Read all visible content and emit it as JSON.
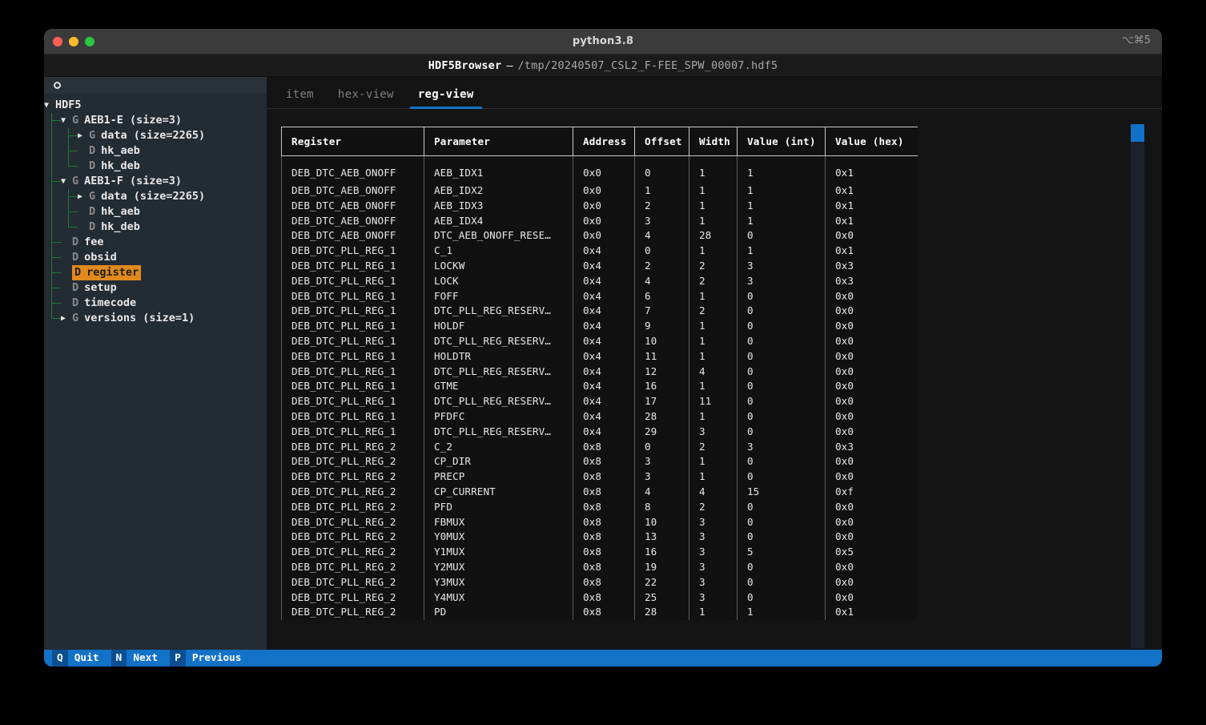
{
  "window": {
    "title": "python3.8",
    "shortcut": "⌥⌘5",
    "traffic_lights": [
      "close",
      "minimize",
      "zoom"
    ]
  },
  "app_header": {
    "program": "HDF5Browser",
    "separator": "—",
    "path": "/tmp/20240507_CSL2_F-FEE_SPW_00007.hdf5"
  },
  "sidebar": {
    "header_icon": "circle-icon",
    "tree": [
      {
        "indent": 0,
        "arrow": "▼",
        "type": "",
        "label": "HDF5",
        "selected": false
      },
      {
        "indent": 1,
        "arrow": "▼",
        "type": "G",
        "label": "AEB1-E (size=3)",
        "selected": false
      },
      {
        "indent": 2,
        "arrow": "▶",
        "type": "G",
        "label": "data (size=2265)",
        "selected": false
      },
      {
        "indent": 2,
        "arrow": "",
        "type": "D",
        "label": "hk_aeb",
        "selected": false
      },
      {
        "indent": 2,
        "arrow": "",
        "type": "D",
        "label": "hk_deb",
        "selected": false
      },
      {
        "indent": 1,
        "arrow": "▼",
        "type": "G",
        "label": "AEB1-F (size=3)",
        "selected": false
      },
      {
        "indent": 2,
        "arrow": "▶",
        "type": "G",
        "label": "data (size=2265)",
        "selected": false
      },
      {
        "indent": 2,
        "arrow": "",
        "type": "D",
        "label": "hk_aeb",
        "selected": false
      },
      {
        "indent": 2,
        "arrow": "",
        "type": "D",
        "label": "hk_deb",
        "selected": false
      },
      {
        "indent": 1,
        "arrow": "",
        "type": "D",
        "label": "fee",
        "selected": false
      },
      {
        "indent": 1,
        "arrow": "",
        "type": "D",
        "label": "obsid",
        "selected": false
      },
      {
        "indent": 1,
        "arrow": "",
        "type": "D",
        "label": "register",
        "selected": true
      },
      {
        "indent": 1,
        "arrow": "",
        "type": "D",
        "label": "setup",
        "selected": false
      },
      {
        "indent": 1,
        "arrow": "",
        "type": "D",
        "label": "timecode",
        "selected": false
      },
      {
        "indent": 1,
        "arrow": "▶",
        "type": "G",
        "label": "versions (size=1)",
        "selected": false
      }
    ]
  },
  "tabs": [
    {
      "label": "item",
      "active": false
    },
    {
      "label": "hex-view",
      "active": false
    },
    {
      "label": "reg-view",
      "active": true
    }
  ],
  "table": {
    "columns": [
      "Register",
      "Parameter",
      "Address",
      "Offset",
      "Width",
      "Value (int)",
      "Value (hex)"
    ],
    "rows": [
      [
        "DEB_DTC_AEB_ONOFF",
        "AEB_IDX1",
        "0x0",
        "0",
        "1",
        "1",
        "0x1"
      ],
      [
        "DEB_DTC_AEB_ONOFF",
        "AEB_IDX2",
        "0x0",
        "1",
        "1",
        "1",
        "0x1"
      ],
      [
        "DEB_DTC_AEB_ONOFF",
        "AEB_IDX3",
        "0x0",
        "2",
        "1",
        "1",
        "0x1"
      ],
      [
        "DEB_DTC_AEB_ONOFF",
        "AEB_IDX4",
        "0x0",
        "3",
        "1",
        "1",
        "0x1"
      ],
      [
        "DEB_DTC_AEB_ONOFF",
        "DTC_AEB_ONOFF_RESE…",
        "0x0",
        "4",
        "28",
        "0",
        "0x0"
      ],
      [
        "DEB_DTC_PLL_REG_1",
        "C_1",
        "0x4",
        "0",
        "1",
        "1",
        "0x1"
      ],
      [
        "DEB_DTC_PLL_REG_1",
        "LOCKW",
        "0x4",
        "2",
        "2",
        "3",
        "0x3"
      ],
      [
        "DEB_DTC_PLL_REG_1",
        "LOCK",
        "0x4",
        "4",
        "2",
        "3",
        "0x3"
      ],
      [
        "DEB_DTC_PLL_REG_1",
        "FOFF",
        "0x4",
        "6",
        "1",
        "0",
        "0x0"
      ],
      [
        "DEB_DTC_PLL_REG_1",
        "DTC_PLL_REG_RESERV…",
        "0x4",
        "7",
        "2",
        "0",
        "0x0"
      ],
      [
        "DEB_DTC_PLL_REG_1",
        "HOLDF",
        "0x4",
        "9",
        "1",
        "0",
        "0x0"
      ],
      [
        "DEB_DTC_PLL_REG_1",
        "DTC_PLL_REG_RESERV…",
        "0x4",
        "10",
        "1",
        "0",
        "0x0"
      ],
      [
        "DEB_DTC_PLL_REG_1",
        "HOLDTR",
        "0x4",
        "11",
        "1",
        "0",
        "0x0"
      ],
      [
        "DEB_DTC_PLL_REG_1",
        "DTC_PLL_REG_RESERV…",
        "0x4",
        "12",
        "4",
        "0",
        "0x0"
      ],
      [
        "DEB_DTC_PLL_REG_1",
        "GTME",
        "0x4",
        "16",
        "1",
        "0",
        "0x0"
      ],
      [
        "DEB_DTC_PLL_REG_1",
        "DTC_PLL_REG_RESERV…",
        "0x4",
        "17",
        "11",
        "0",
        "0x0"
      ],
      [
        "DEB_DTC_PLL_REG_1",
        "PFDFC",
        "0x4",
        "28",
        "1",
        "0",
        "0x0"
      ],
      [
        "DEB_DTC_PLL_REG_1",
        "DTC_PLL_REG_RESERV…",
        "0x4",
        "29",
        "3",
        "0",
        "0x0"
      ],
      [
        "DEB_DTC_PLL_REG_2",
        "C_2",
        "0x8",
        "0",
        "2",
        "3",
        "0x3"
      ],
      [
        "DEB_DTC_PLL_REG_2",
        "CP_DIR",
        "0x8",
        "3",
        "1",
        "0",
        "0x0"
      ],
      [
        "DEB_DTC_PLL_REG_2",
        "PRECP",
        "0x8",
        "3",
        "1",
        "0",
        "0x0"
      ],
      [
        "DEB_DTC_PLL_REG_2",
        "CP_CURRENT",
        "0x8",
        "4",
        "4",
        "15",
        "0xf"
      ],
      [
        "DEB_DTC_PLL_REG_2",
        "PFD",
        "0x8",
        "8",
        "2",
        "0",
        "0x0"
      ],
      [
        "DEB_DTC_PLL_REG_2",
        "FBMUX",
        "0x8",
        "10",
        "3",
        "0",
        "0x0"
      ],
      [
        "DEB_DTC_PLL_REG_2",
        "Y0MUX",
        "0x8",
        "13",
        "3",
        "0",
        "0x0"
      ],
      [
        "DEB_DTC_PLL_REG_2",
        "Y1MUX",
        "0x8",
        "16",
        "3",
        "5",
        "0x5"
      ],
      [
        "DEB_DTC_PLL_REG_2",
        "Y2MUX",
        "0x8",
        "19",
        "3",
        "0",
        "0x0"
      ],
      [
        "DEB_DTC_PLL_REG_2",
        "Y3MUX",
        "0x8",
        "22",
        "3",
        "0",
        "0x0"
      ],
      [
        "DEB_DTC_PLL_REG_2",
        "Y4MUX",
        "0x8",
        "25",
        "3",
        "0",
        "0x0"
      ],
      [
        "DEB_DTC_PLL_REG_2",
        "PD",
        "0x8",
        "28",
        "1",
        "1",
        "0x1"
      ]
    ]
  },
  "statusbar": [
    {
      "key": "Q",
      "label": "Quit"
    },
    {
      "key": "N",
      "label": "Next"
    },
    {
      "key": "P",
      "label": "Previous"
    }
  ],
  "colors": {
    "accent_blue": "#1272c8",
    "selection_orange": "#e08a1e",
    "tree_guide_green": "#1f7a3a",
    "sidebar_bg": "#232b33",
    "main_bg": "#141414"
  }
}
